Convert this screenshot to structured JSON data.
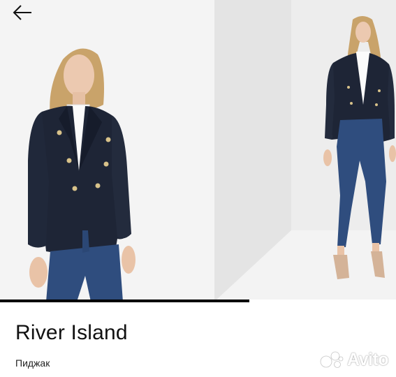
{
  "product": {
    "brand": "River Island",
    "category": "Пиджак"
  },
  "gallery": {
    "progress": 0.63
  },
  "watermark": {
    "text": "Avito"
  },
  "icons": {
    "back": "arrow-left-icon",
    "watermark_logo": "avito-logo-icon"
  },
  "colors": {
    "text": "#111111",
    "progress": "#000000",
    "blazer": "#1e2536",
    "jeans": "#2f4d7e"
  }
}
